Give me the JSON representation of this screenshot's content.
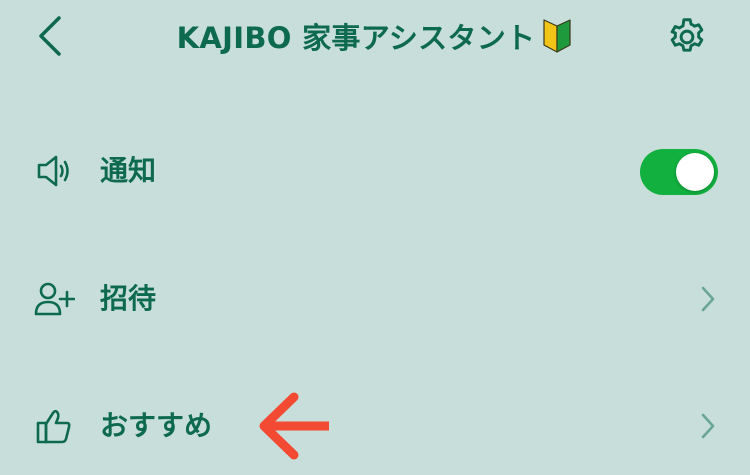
{
  "header": {
    "title": "KAJIBO 家事アシスタント",
    "back_icon": "chevron-left-icon",
    "beginner_icon": "beginner-mark-icon",
    "settings_icon": "gear-icon"
  },
  "rows": [
    {
      "label": "通知",
      "icon": "speaker-icon",
      "control": "toggle",
      "toggle_on": true
    },
    {
      "label": "招待",
      "icon": "add-person-icon",
      "control": "chevron"
    },
    {
      "label": "おすすめ",
      "icon": "thumbs-up-icon",
      "control": "chevron"
    }
  ],
  "annotation": {
    "icon": "red-arrow-left-icon",
    "color": "#f24a33"
  },
  "colors": {
    "background": "#c8deda",
    "primary_text": "#0e6a4e",
    "toggle_on": "#12b03f",
    "chevron": "#6aa694"
  }
}
